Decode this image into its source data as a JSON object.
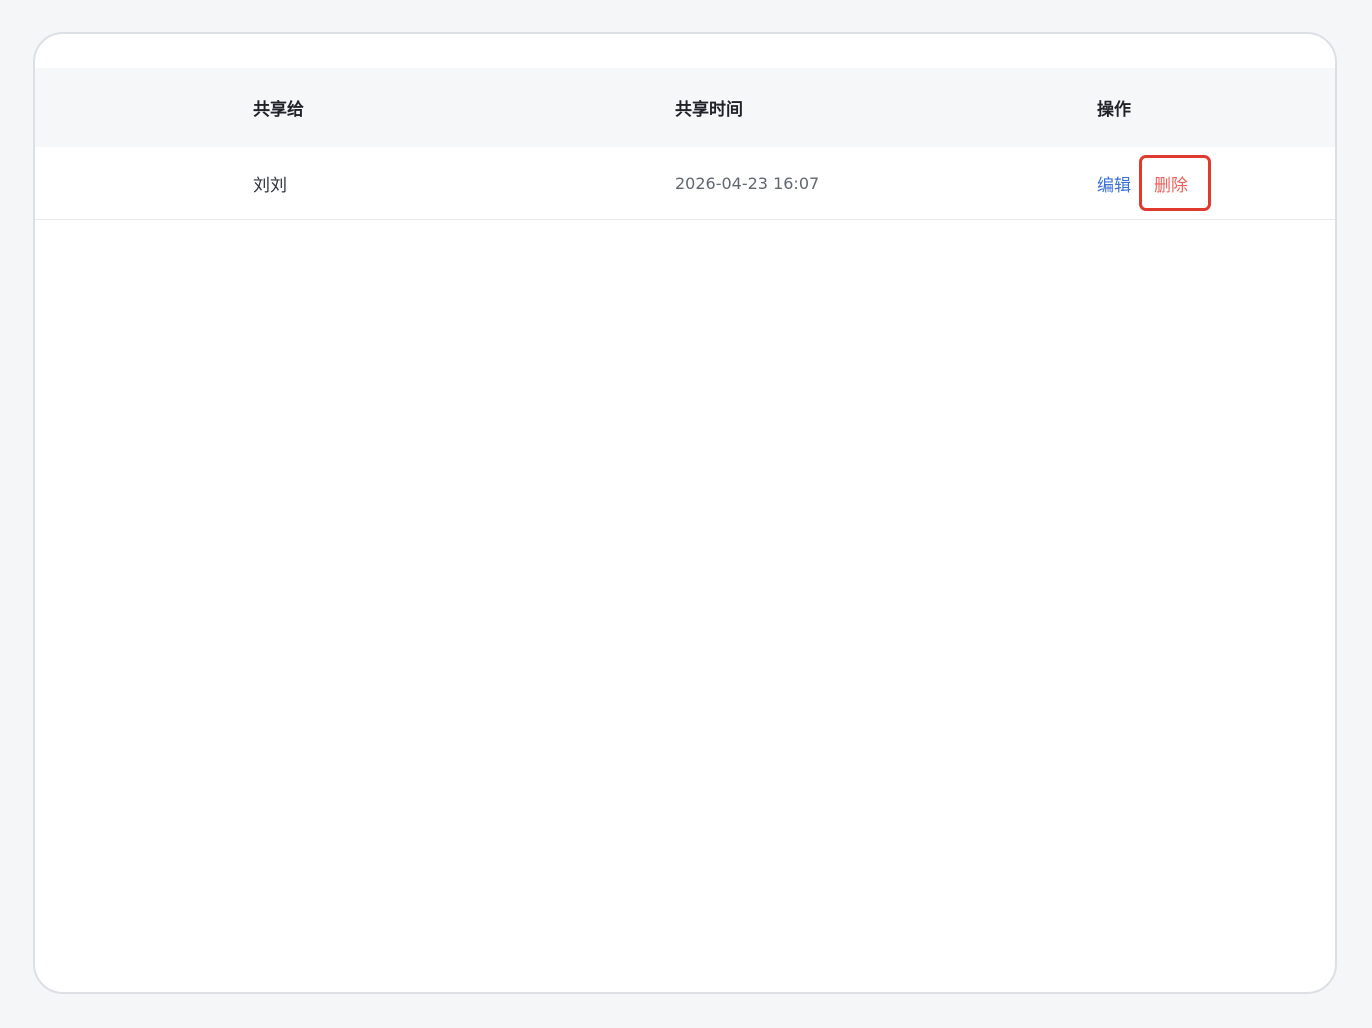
{
  "table": {
    "headers": [
      "共享给",
      "共享时间",
      "操作"
    ],
    "rows": [
      {
        "shared_to": "刘刘",
        "shared_time": "2026-04-23 16:07",
        "actions": {
          "edit": "编辑",
          "delete": "删除"
        }
      }
    ]
  },
  "colors": {
    "edit_link": "#3a6fd8",
    "delete_link": "#f0605a",
    "highlight_border": "#e03a2f"
  }
}
